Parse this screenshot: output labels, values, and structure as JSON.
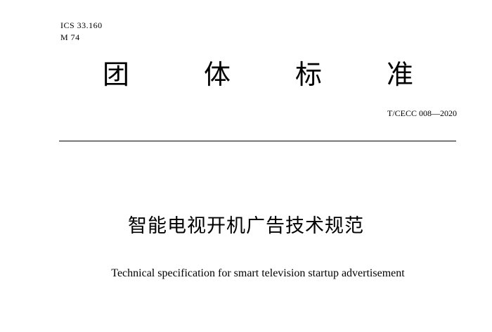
{
  "header": {
    "ics_code": "ICS 33.160",
    "ccs_code": "M 74"
  },
  "standard_type": {
    "chars": [
      "团",
      "体",
      "标",
      "准"
    ]
  },
  "standard_number": "T/CECC 008—2020",
  "title": {
    "chinese": "智能电视开机广告技术规范",
    "english": "Technical specification for smart television startup advertisement"
  }
}
